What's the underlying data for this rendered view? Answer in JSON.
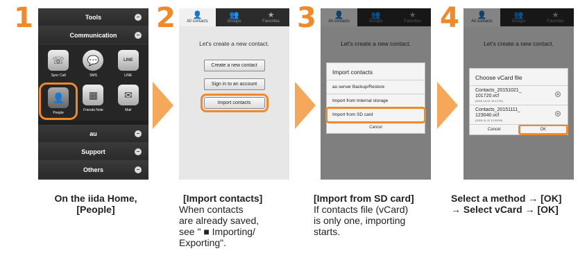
{
  "steps": [
    "1",
    "2",
    "3",
    "4"
  ],
  "screen1": {
    "menu_top": [
      "Tools",
      "Communication"
    ],
    "apps": [
      {
        "icon": "sync-call-icon",
        "glyph": "☏",
        "label": "Sync Call"
      },
      {
        "icon": "sms-icon",
        "glyph": "💬",
        "label": "SMS",
        "sub": "au"
      },
      {
        "icon": "line-icon",
        "glyph": "LINE",
        "label": "LINE"
      },
      {
        "icon": "people-icon",
        "glyph": "👤",
        "label": "People"
      },
      {
        "icon": "friends-note-icon",
        "glyph": "▦",
        "label": "Friends Note"
      },
      {
        "icon": "mail-icon",
        "glyph": "✉",
        "label": "Mail"
      }
    ],
    "menu_bottom": [
      "au",
      "Support",
      "Others"
    ],
    "ctl": "−"
  },
  "tabs": {
    "all": "All contacts",
    "groups": "Groups",
    "favorites": "Favorites"
  },
  "screen2": {
    "lead": "Let's create a new contact.",
    "buttons": [
      "Create a new contact",
      "Sign in to an account",
      "Import contacts"
    ]
  },
  "screen3": {
    "title": "Import contacts",
    "items": [
      "au server Backup/Restore",
      "Import from Internal storage",
      "Import from SD card"
    ],
    "cancel": "Cancel"
  },
  "screen4": {
    "title": "Choose vCard file",
    "files": [
      {
        "name": "Contacts_20151021_\n101720.vcf",
        "date": "(2015-10-21 10:17:20)"
      },
      {
        "name": "Contacts_20151111_\n123040.vcf",
        "date": "(2015-11-11 12:30:50)"
      }
    ],
    "cancel": "Cancel",
    "ok": "OK"
  },
  "captions": {
    "c1": "On the iida Home,\n[People]",
    "c2_title": "[Import contacts]",
    "c2_body": "When contacts\nare already saved,\nsee \" ■ Importing/\nExporting\".",
    "c3_title": "[Import from SD card]",
    "c3_body": "If contacts file (vCard)\nis only one, importing\nstarts.",
    "c4": "Select a method → [OK]\n→ Select vCard → [OK]"
  },
  "colors": {
    "accent": "#f08a28"
  }
}
